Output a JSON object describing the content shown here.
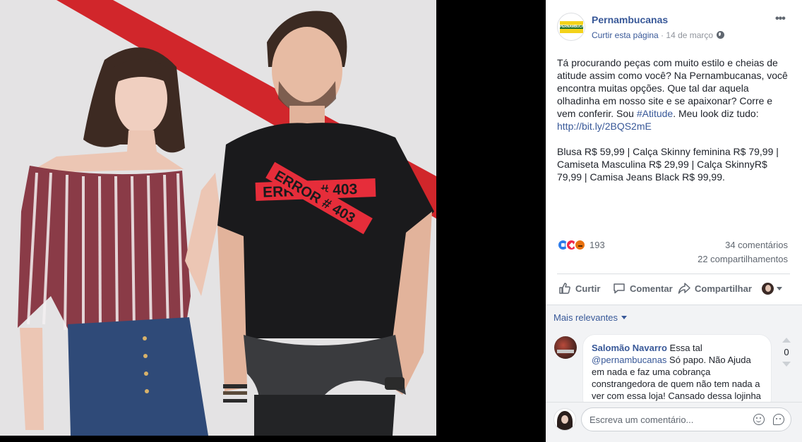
{
  "post": {
    "page_name": "Pernambucanas",
    "logo_text": "PERNAMBUCANAS",
    "like_page": "Curtir esta página",
    "separator": " · ",
    "date": "14 de março",
    "more": "•••",
    "text_part1": "Tá procurando peças com muito estilo e cheias de atitude assim como você? Na Pernambucanas, você encontra muitas opções. Que tal dar aquela olhadinha em nosso site e se apaixonar? Corre e vem conferir. Sou ",
    "hashtag": "#Atitude",
    "text_part2": ". Meu look diz tudo: ",
    "link": "http://bit.ly/2BQS2mE",
    "prices": "Blusa R$ 59,99 | Calça Skinny feminina R$ 79,99 | Camiseta Masculina R$ 29,99 | Calça SkinnyR$ 79,99 | Camisa Jeans Black R$ 99,99."
  },
  "photo": {
    "shirt_text_1": "ERROR # 403",
    "shirt_text_2": "ERROR # 403"
  },
  "stats": {
    "reactions": [
      "like",
      "love",
      "angry"
    ],
    "reaction_count": "193",
    "comments": "34 comentários",
    "shares": "22 compartilhamentos"
  },
  "actions": {
    "like": "Curtir",
    "comment": "Comentar",
    "share": "Compartilhar"
  },
  "comments": {
    "sort_label": "Mais relevantes",
    "items": [
      {
        "author": "Salomão Navarro",
        "text_before": " Essa tal ",
        "mention": "@pernambucanas",
        "text_after": " Só papo. Não Ajuda em nada e faz uma cobrança constrangedora de quem não tem nada a ver com essa loja! Cansado dessa lojinha",
        "votes": "0"
      }
    ],
    "composer_placeholder": "Escreva um comentário..."
  },
  "colors": {
    "link_blue": "#385898",
    "background_red": "#d1262b",
    "shirt_red": "#e62d3a"
  }
}
